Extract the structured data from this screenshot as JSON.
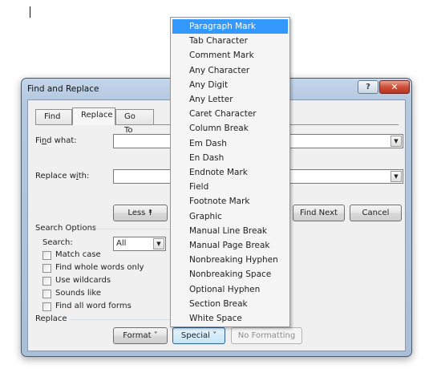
{
  "window": {
    "title": "Find and Replace",
    "help_label": "?",
    "close_label": "✕"
  },
  "tabs": [
    {
      "label": "Find",
      "accel": "d"
    },
    {
      "label": "Replace",
      "accel": "p"
    },
    {
      "label": "Go To",
      "accel": "G"
    }
  ],
  "find": {
    "label_pre": "Fi",
    "label_accel": "n",
    "label_post": "d what:",
    "value": ""
  },
  "replace": {
    "label_pre": "Replace w",
    "label_accel": "i",
    "label_post": "th:",
    "value": ""
  },
  "buttons": {
    "less": "Less ⯭",
    "find_next": "Find Next",
    "cancel": "Cancel",
    "format": "Format ˅",
    "special": "Special ˅",
    "no_formatting": "No Formatting"
  },
  "search_options": {
    "title": "Search Options",
    "search_label": "Search:",
    "search_value": "All",
    "checkboxes": [
      {
        "label": "Match case",
        "checked": false
      },
      {
        "label": "Find whole words only",
        "checked": false
      },
      {
        "label": "Use wildcards",
        "checked": false
      },
      {
        "label": "Sounds like",
        "checked": false
      },
      {
        "label": "Find all word forms",
        "checked": false
      }
    ]
  },
  "replace_section": {
    "title": "Replace"
  },
  "special_menu": {
    "items": [
      "Paragraph Mark",
      "Tab Character",
      "Comment Mark",
      "Any Character",
      "Any Digit",
      "Any Letter",
      "Caret Character",
      "Column Break",
      "Em Dash",
      "En Dash",
      "Endnote Mark",
      "Field",
      "Footnote Mark",
      "Graphic",
      "Manual Line Break",
      "Manual Page Break",
      "Nonbreaking Hyphen",
      "Nonbreaking Space",
      "Optional Hyphen",
      "Section Break",
      "White Space"
    ],
    "highlighted": "Paragraph Mark"
  },
  "colors": {
    "highlight": "#3399ff",
    "close": "#c9452f"
  },
  "icons": {
    "dropdown": "chevron-down-icon",
    "close": "close-icon",
    "help": "help-icon"
  }
}
